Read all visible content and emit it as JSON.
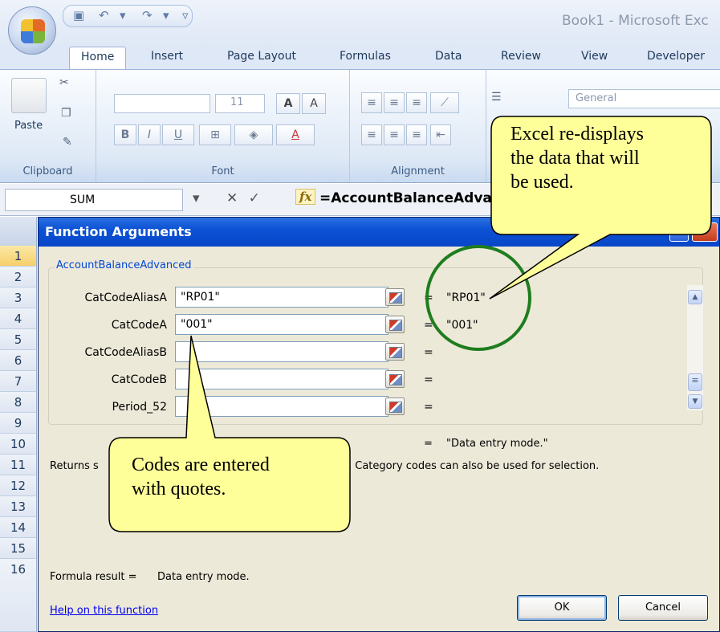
{
  "window": {
    "title": "Book1 - Microsoft Exc"
  },
  "tabs": [
    "Home",
    "Insert",
    "Page Layout",
    "Formulas",
    "Data",
    "Review",
    "View",
    "Developer"
  ],
  "ribbon": {
    "paste_label": "Paste",
    "font_size": "11",
    "number_format": "General",
    "groups": [
      "Clipboard",
      "Font",
      "Alignment"
    ]
  },
  "formula_bar": {
    "name_box": "SUM",
    "formula": "=AccountBalanceAdva"
  },
  "rows": [
    "1",
    "2",
    "3",
    "4",
    "5",
    "6",
    "7",
    "8",
    "9",
    "10",
    "11",
    "12",
    "13",
    "14",
    "15",
    "16"
  ],
  "dialog": {
    "title": "Function Arguments",
    "function_name": "AccountBalanceAdvanced",
    "args": [
      {
        "label": "CatCodeAliasA",
        "value": "\"RP01\"",
        "eq": "=",
        "result": "\"RP01\""
      },
      {
        "label": "CatCodeA",
        "value": "\"001\"",
        "eq": "=",
        "result": "\"001\""
      },
      {
        "label": "CatCodeAliasB",
        "value": "",
        "eq": "=",
        "result": ""
      },
      {
        "label": "CatCodeB",
        "value": "",
        "eq": "=",
        "result": ""
      },
      {
        "label": "Period_52",
        "value": "",
        "eq": "=",
        "result": ""
      }
    ],
    "overall_eq": "=",
    "overall_result": "\"Data entry mode.\"",
    "description_start": "Returns s",
    "description_end": ". Category codes can also be used for selection.",
    "formula_result_label": "Formula result =",
    "formula_result_value": "Data entry mode.",
    "help_link": "Help on this function",
    "ok_label": "OK",
    "cancel_label": "Cancel"
  },
  "callouts": {
    "top_right": [
      "Excel re-displays",
      "the data that will",
      "be used."
    ],
    "bottom_left": [
      "Codes are entered",
      "with quotes."
    ]
  }
}
